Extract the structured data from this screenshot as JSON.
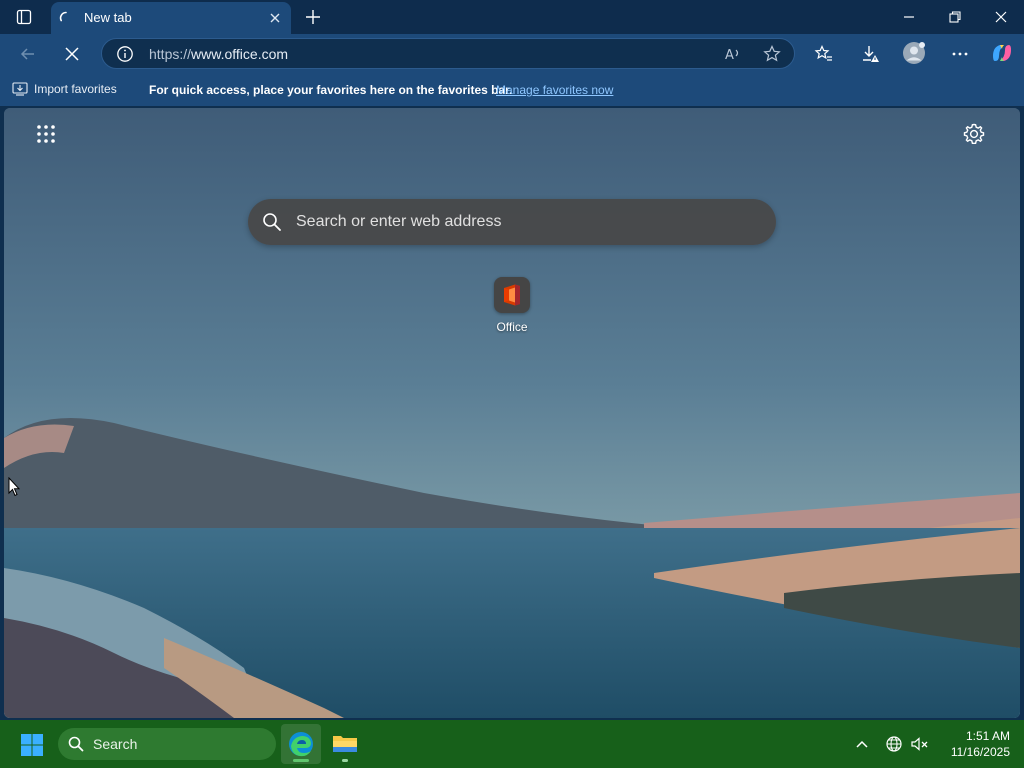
{
  "browser": {
    "tab": {
      "title": "New tab"
    },
    "address": {
      "protocol": "https://",
      "host": "www.office.com"
    },
    "favorites_bar": {
      "import_label": "Import favorites",
      "message": "For quick access, place your favorites here on the favorites bar.",
      "manage_link": "Manage favorites now"
    }
  },
  "newtab": {
    "search_placeholder": "Search or enter web address",
    "tiles": [
      {
        "label": "Office",
        "icon": "office-icon"
      }
    ]
  },
  "taskbar": {
    "search_label": "Search",
    "apps": [
      {
        "name": "Microsoft Edge",
        "icon": "edge-icon",
        "active": true
      },
      {
        "name": "File Explorer",
        "icon": "file-explorer-icon",
        "active": false
      }
    ],
    "time": "1:51 AM",
    "date": "11/16/2025"
  },
  "colors": {
    "titlebar": "#0e2c4d",
    "toolbar": "#1d4a7a",
    "link": "#8fc7ff",
    "taskbar": "#17601a"
  }
}
